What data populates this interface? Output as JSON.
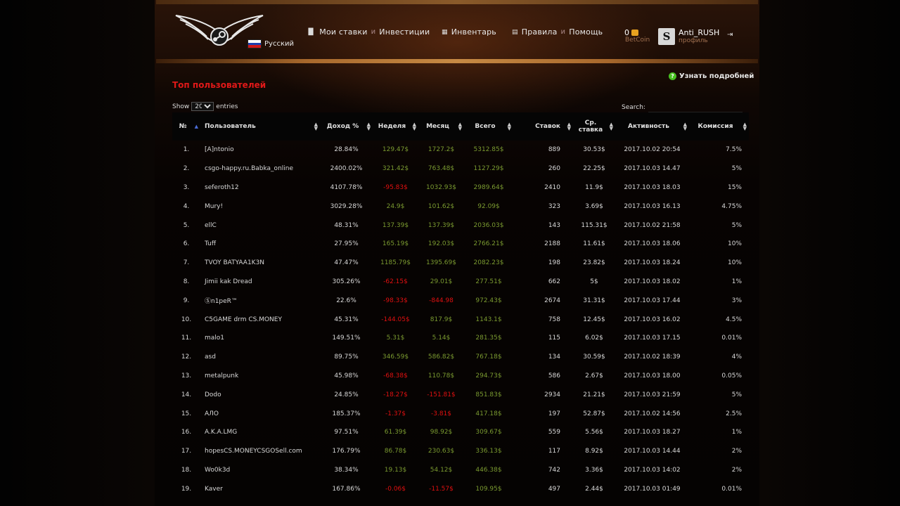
{
  "header": {
    "language": "Русский",
    "nav": [
      {
        "icon": "bar-chart-icon",
        "label1": "Мои ставки",
        "sep": "и",
        "label2": "Инвестиции"
      },
      {
        "icon": "grid-icon",
        "label1": "Инвентарь",
        "sep": "",
        "label2": ""
      },
      {
        "icon": "book-icon",
        "label1": "Правила",
        "sep": "и",
        "label2": "Помощь"
      }
    ],
    "balance": "0",
    "balance_label": "BetCoin",
    "username": "Anti_RUSH",
    "profile_label": "профиль",
    "avatar_letter": "S"
  },
  "learn_more": "Узнать подробней",
  "section_title": "Топ пользователей",
  "table_controls": {
    "show_label": "Show",
    "entries_value": "20",
    "entries_label": "entries",
    "search_label": "Search:"
  },
  "colors": {
    "accent_red": "#e01818",
    "positive_green": "#7a9a30",
    "negative_red": "#e01010",
    "header_bronze": "#a8682c"
  },
  "table": {
    "columns": [
      "№",
      "Пользователь",
      "Доход %",
      "Неделя",
      "Месяц",
      "Всего",
      "Ставок",
      "Ср. ставка",
      "Активность",
      "Комиссия"
    ],
    "rows": [
      {
        "n": "1.",
        "user": "[A]ntonio",
        "income": "28.84%",
        "week": "129.47$",
        "week_neg": false,
        "month": "1727.2$",
        "month_neg": false,
        "total": "5312.85$",
        "bets": "889",
        "avg": "30.53$",
        "activity": "2017.10.02 20:54",
        "fee": "7.5%"
      },
      {
        "n": "2.",
        "user": "csgo-happy.ru.Babka_online",
        "income": "2400.02%",
        "week": "321.42$",
        "week_neg": false,
        "month": "763.48$",
        "month_neg": false,
        "total": "1127.29$",
        "bets": "260",
        "avg": "22.25$",
        "activity": "2017.10.03 14.47",
        "fee": "5%"
      },
      {
        "n": "3.",
        "user": "seferoth12",
        "income": "4107.78%",
        "week": "-95.83$",
        "week_neg": true,
        "month": "1032.93$",
        "month_neg": false,
        "total": "2989.64$",
        "bets": "2410",
        "avg": "11.9$",
        "activity": "2017.10.03 18.03",
        "fee": "15%"
      },
      {
        "n": "4.",
        "user": "Mury!",
        "income": "3029.28%",
        "week": "24.9$",
        "week_neg": false,
        "month": "101.62$",
        "month_neg": false,
        "total": "92.09$",
        "bets": "323",
        "avg": "3.69$",
        "activity": "2017.10.03 16.13",
        "fee": "4.75%"
      },
      {
        "n": "5.",
        "user": "ellC",
        "income": "48.31%",
        "week": "137.39$",
        "week_neg": false,
        "month": "137.39$",
        "month_neg": false,
        "total": "2036.03$",
        "bets": "143",
        "avg": "115.31$",
        "activity": "2017.10.02 21:58",
        "fee": "5%"
      },
      {
        "n": "6.",
        "user": "Tuff",
        "income": "27.95%",
        "week": "165.19$",
        "week_neg": false,
        "month": "192.03$",
        "month_neg": false,
        "total": "2766.21$",
        "bets": "2188",
        "avg": "11.61$",
        "activity": "2017.10.03 18.06",
        "fee": "10%"
      },
      {
        "n": "7.",
        "user": "TVOY BATYAA1K3N",
        "income": "47.47%",
        "week": "1185.79$",
        "week_neg": false,
        "month": "1395.69$",
        "month_neg": false,
        "total": "2082.23$",
        "bets": "198",
        "avg": "23.82$",
        "activity": "2017.10.03 18.24",
        "fee": "10%"
      },
      {
        "n": "8.",
        "user": "Jimii kak Dread",
        "income": "305.26%",
        "week": "-62.15$",
        "week_neg": true,
        "month": "29.01$",
        "month_neg": false,
        "total": "277.51$",
        "bets": "662",
        "avg": "5$",
        "activity": "2017.10.03 18.02",
        "fee": "1%"
      },
      {
        "n": "9.",
        "user": "Ⓢn1peR™",
        "income": "22.6%",
        "week": "-98.33$",
        "week_neg": true,
        "month": "-844.98",
        "month_neg": true,
        "total": "972.43$",
        "bets": "2674",
        "avg": "31.31$",
        "activity": "2017.10.03 17.44",
        "fee": "3%"
      },
      {
        "n": "10.",
        "user": "C5GAME drm CS.MONEY",
        "income": "45.31%",
        "week": "-144.05$",
        "week_neg": true,
        "month": "817.9$",
        "month_neg": false,
        "total": "1143.1$",
        "bets": "758",
        "avg": "12.45$",
        "activity": "2017.10.03 16.02",
        "fee": "4.5%"
      },
      {
        "n": "11.",
        "user": "malo1",
        "income": "149.51%",
        "week": "5.31$",
        "week_neg": false,
        "month": "5.14$",
        "month_neg": false,
        "total": "281.35$",
        "bets": "115",
        "avg": "6.02$",
        "activity": "2017.10.03 17.15",
        "fee": "0.01%"
      },
      {
        "n": "12.",
        "user": "asd",
        "income": "89.75%",
        "week": "346.59$",
        "week_neg": false,
        "month": "586.82$",
        "month_neg": false,
        "total": "767.18$",
        "bets": "134",
        "avg": "30.59$",
        "activity": "2017.10.02 18:39",
        "fee": "4%"
      },
      {
        "n": "13.",
        "user": "metalpunk",
        "income": "45.98%",
        "week": "-68.38$",
        "week_neg": true,
        "month": "110.78$",
        "month_neg": false,
        "total": "294.73$",
        "bets": "586",
        "avg": "2.67$",
        "activity": "2017.10.03 18.00",
        "fee": "0.05%"
      },
      {
        "n": "14.",
        "user": "Dodo",
        "income": "24.85%",
        "week": "-18.27$",
        "week_neg": true,
        "month": "-151.81$",
        "month_neg": true,
        "total": "851.83$",
        "bets": "2934",
        "avg": "21.21$",
        "activity": "2017.10.03 21:59",
        "fee": "5%"
      },
      {
        "n": "15.",
        "user": "АЛО",
        "income": "185.37%",
        "week": "-1.37$",
        "week_neg": true,
        "month": "-3.81$",
        "month_neg": true,
        "total": "417.18$",
        "bets": "197",
        "avg": "52.87$",
        "activity": "2017.10.02 14:56",
        "fee": "2.5%"
      },
      {
        "n": "16.",
        "user": "A.K.A.LMG",
        "income": "97.51%",
        "week": "61.39$",
        "week_neg": false,
        "month": "98.92$",
        "month_neg": false,
        "total": "309.67$",
        "bets": "559",
        "avg": "5.56$",
        "activity": "2017.10.03 18.27",
        "fee": "1%"
      },
      {
        "n": "17.",
        "user": "hopesCS.MONEYCSGOSell.com",
        "income": "176.79%",
        "week": "86.78$",
        "week_neg": false,
        "month": "230.63$",
        "month_neg": false,
        "total": "336.13$",
        "bets": "117",
        "avg": "8.92$",
        "activity": "2017.10.03 14.44",
        "fee": "2%"
      },
      {
        "n": "18.",
        "user": "Wo0k3d",
        "income": "38.34%",
        "week": "19.13$",
        "week_neg": false,
        "month": "54.12$",
        "month_neg": false,
        "total": "446.38$",
        "bets": "742",
        "avg": "3.36$",
        "activity": "2017.10.03 14:02",
        "fee": "2%"
      },
      {
        "n": "19.",
        "user": "Kaver",
        "income": "167.86%",
        "week": "-0.06$",
        "week_neg": true,
        "month": "-11.57$",
        "month_neg": true,
        "total": "109.95$",
        "bets": "497",
        "avg": "2.44$",
        "activity": "2017.10.03 01:49",
        "fee": "0.01%"
      }
    ]
  }
}
